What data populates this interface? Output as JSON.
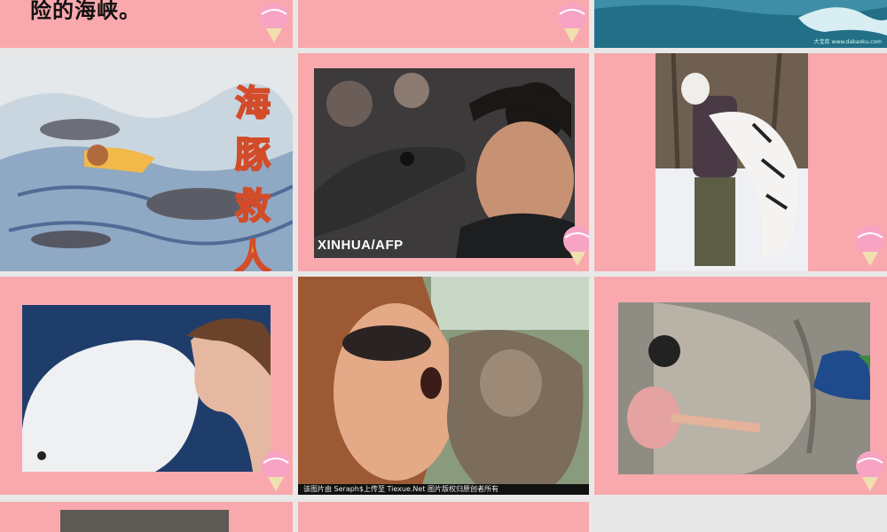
{
  "thumbnails": [
    {
      "id": "s1",
      "text": "险的海峡。",
      "kind": "text-slide"
    },
    {
      "id": "s2",
      "kind": "blank"
    },
    {
      "id": "s3",
      "kind": "ocean-photo",
      "watermark": "大宝库 www.dabaoku.com"
    },
    {
      "id": "s4",
      "kind": "illustration",
      "title_chars": [
        "海",
        "豚",
        "救",
        "人"
      ]
    },
    {
      "id": "s5",
      "kind": "photo",
      "credit": "XINHUA/AFP"
    },
    {
      "id": "s6",
      "kind": "photo",
      "subject": "white-tiger-hug"
    },
    {
      "id": "s7",
      "kind": "photo",
      "subject": "beluga-girl"
    },
    {
      "id": "s8",
      "kind": "photo",
      "caption": "该图片由 Seraph$上传至 Tiexue.Net 图片版权归原创者所有"
    },
    {
      "id": "s9",
      "kind": "photo",
      "subject": "girl-feeding-peacock"
    },
    {
      "id": "s10",
      "kind": "partial-photo"
    },
    {
      "id": "s11",
      "kind": "blank"
    }
  ],
  "colors": {
    "slide_bg": "#f9a9ad",
    "gap": "#e8e8e8",
    "balloon": "#f7a4c4"
  }
}
